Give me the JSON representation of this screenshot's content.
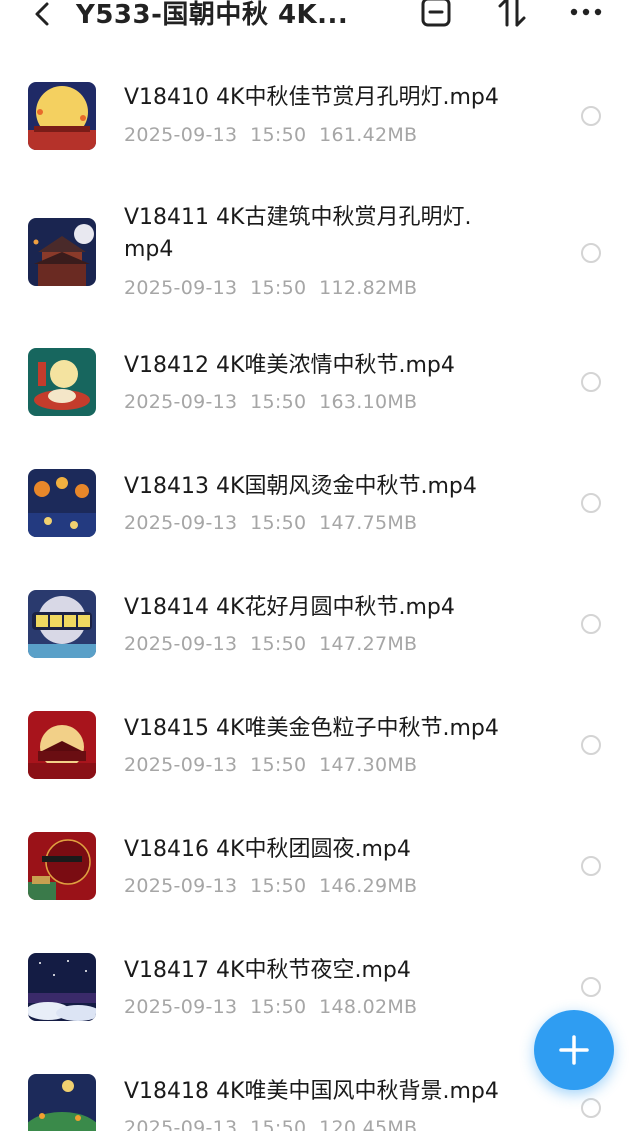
{
  "header": {
    "title": "Y533-国朝中秋 4K...",
    "back_icon": "back-icon",
    "select_icon": "select-icon",
    "sort_icon": "sort-icon",
    "more_icon": "more-icon"
  },
  "files": [
    {
      "name": "V18410 4K中秋佳节赏月孔明灯.mp4",
      "date": "2025-09-13",
      "time": "15:50",
      "size": "161.42MB"
    },
    {
      "name": "V18411 4K古建筑中秋赏月孔明灯.mp4",
      "date": "2025-09-13",
      "time": "15:50",
      "size": "112.82MB"
    },
    {
      "name": "V18412 4K唯美浓情中秋节.mp4",
      "date": "2025-09-13",
      "time": "15:50",
      "size": "163.10MB"
    },
    {
      "name": "V18413 4K国朝风烫金中秋节.mp4",
      "date": "2025-09-13",
      "time": "15:50",
      "size": "147.75MB"
    },
    {
      "name": "V18414 4K花好月圆中秋节.mp4",
      "date": "2025-09-13",
      "time": "15:50",
      "size": "147.27MB"
    },
    {
      "name": "V18415 4K唯美金色粒子中秋节.mp4",
      "date": "2025-09-13",
      "time": "15:50",
      "size": "147.30MB"
    },
    {
      "name": "V18416 4K中秋团圆夜.mp4",
      "date": "2025-09-13",
      "time": "15:50",
      "size": "146.29MB"
    },
    {
      "name": "V18417 4K中秋节夜空.mp4",
      "date": "2025-09-13",
      "time": "15:50",
      "size": "148.02MB"
    },
    {
      "name": "V18418 4K唯美中国风中秋背景.mp4",
      "date": "2025-09-13",
      "time": "15:50",
      "size": "120.45MB"
    }
  ],
  "fab": {
    "icon": "plus-icon"
  },
  "colors": {
    "accent": "#2f9df2",
    "meta_text": "#a6a6a6"
  }
}
